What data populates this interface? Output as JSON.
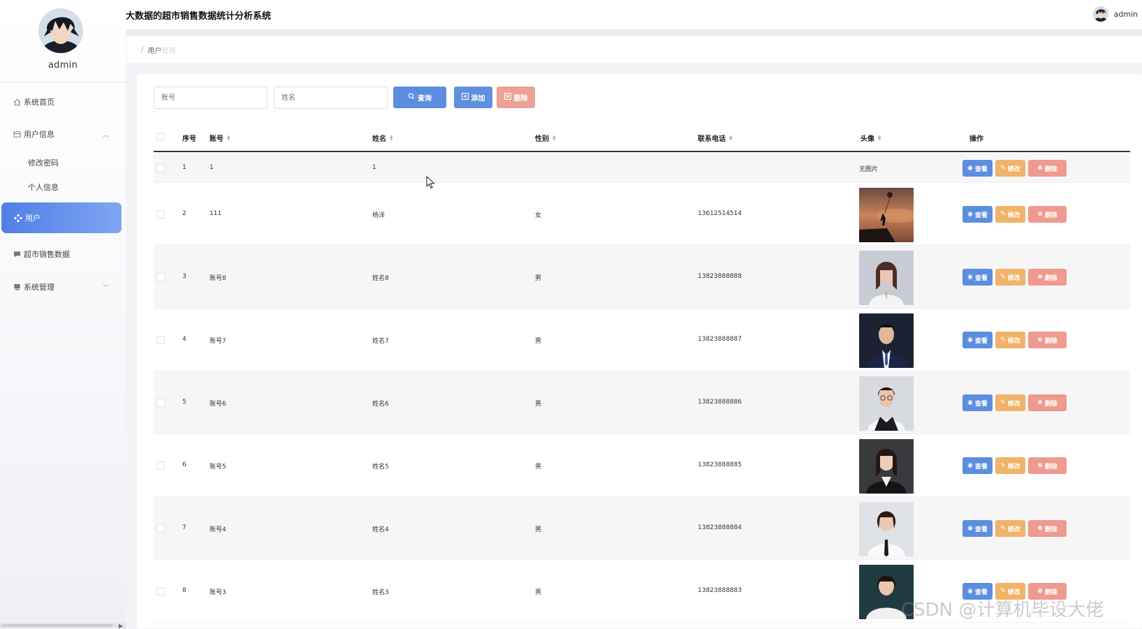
{
  "app": {
    "title": "大数据的超市销售数据统计分析系统"
  },
  "header": {
    "username": "admin"
  },
  "sidebar": {
    "username": "admin",
    "items": [
      {
        "label": "系统首页",
        "icon": "home-icon"
      },
      {
        "label": "用户信息",
        "icon": "user-info-icon",
        "arrow": "^"
      },
      {
        "label": "修改密码"
      },
      {
        "label": "个人信息"
      },
      {
        "label": "用户",
        "icon": "users-icon",
        "active": true
      },
      {
        "label": "超市销售数据",
        "icon": "chat-icon"
      },
      {
        "label": "系统管理",
        "icon": "system-icon",
        "arrow": "v"
      }
    ]
  },
  "breadcrumb": {
    "sep": "/",
    "current": "用户",
    "faded": "管理"
  },
  "search": {
    "account_placeholder": "账号",
    "name_placeholder": "姓名",
    "query_label": "查询",
    "add_label": "添加",
    "delete_label": "删除"
  },
  "table": {
    "columns": [
      "序号",
      "账号",
      "姓名",
      "性别",
      "联系电话",
      "头像",
      "操作"
    ],
    "actions": {
      "view": "查看",
      "edit": "修改",
      "delete": "删除"
    },
    "no_photo": "无图片",
    "rows": [
      {
        "index": "1",
        "account": "1",
        "name": "1",
        "gender": "",
        "phone": "",
        "photo": ""
      },
      {
        "index": "2",
        "account": "111",
        "name": "杨洋",
        "gender": "女",
        "phone": "13612514514",
        "photo": "sunset-balloon"
      },
      {
        "index": "3",
        "account": "账号8",
        "name": "姓名8",
        "gender": "男",
        "phone": "13823888888",
        "photo": "woman-white-blazer"
      },
      {
        "index": "4",
        "account": "账号7",
        "name": "姓名7",
        "gender": "男",
        "phone": "13823888887",
        "photo": "man-navy-suit"
      },
      {
        "index": "5",
        "account": "账号6",
        "name": "姓名6",
        "gender": "男",
        "phone": "13823888886",
        "photo": "woman-glasses-vest"
      },
      {
        "index": "6",
        "account": "账号5",
        "name": "姓名5",
        "gender": "男",
        "phone": "13823888885",
        "photo": "woman-black-suit"
      },
      {
        "index": "7",
        "account": "账号4",
        "name": "姓名4",
        "gender": "男",
        "phone": "13823888884",
        "photo": "woman-white-shirt"
      },
      {
        "index": "8",
        "account": "账号3",
        "name": "姓名3",
        "gender": "男",
        "phone": "13823888883",
        "photo": "woman-white-blouse"
      }
    ]
  },
  "watermark": "CSDN @计算机毕设大佬",
  "colors": {
    "primary": "#5c8ee0",
    "warning": "#f0b36a",
    "danger": "#ee9a8f",
    "active_gradient_start": "#4f7fe6",
    "active_gradient_end": "#7fa6f2"
  }
}
